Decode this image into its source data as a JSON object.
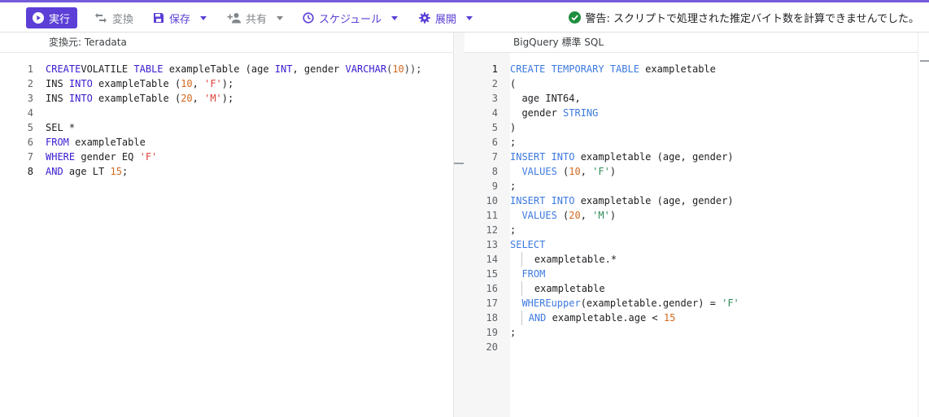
{
  "toolbar": {
    "run_label": "実行",
    "convert_label": "変換",
    "save_label": "保存",
    "share_label": "共有",
    "schedule_label": "スケジュール",
    "deploy_label": "展開",
    "warning_text": "警告: スクリプトで処理された推定バイト数を計算できませんでした。"
  },
  "left_pane": {
    "title": "変換元: Teradata",
    "lines": [
      {
        "n": "1",
        "tokens": [
          [
            "kw",
            "CREATE"
          ],
          [
            "",
            "VOLATILE "
          ],
          [
            "kw",
            "TABLE"
          ],
          [
            "",
            " exampleTable (age "
          ],
          [
            "kw",
            "INT"
          ],
          [
            "",
            ", gender "
          ],
          [
            "kw",
            "VARCHAR"
          ],
          [
            "punc",
            "("
          ],
          [
            "num",
            "10"
          ],
          [
            "punc",
            "));"
          ]
        ]
      },
      {
        "n": "2",
        "tokens": [
          [
            "",
            "INS "
          ],
          [
            "kw",
            "INTO"
          ],
          [
            "",
            " exampleTable ("
          ],
          [
            "num",
            "10"
          ],
          [
            "",
            ", "
          ],
          [
            "str",
            "'F'"
          ],
          [
            "",
            ");"
          ]
        ]
      },
      {
        "n": "3",
        "tokens": [
          [
            "",
            "INS "
          ],
          [
            "kw",
            "INTO"
          ],
          [
            "",
            " exampleTable ("
          ],
          [
            "num",
            "20"
          ],
          [
            "",
            ", "
          ],
          [
            "str",
            "'M'"
          ],
          [
            "",
            ");"
          ]
        ]
      },
      {
        "n": "4",
        "tokens": []
      },
      {
        "n": "5",
        "tokens": [
          [
            "",
            "SEL *"
          ]
        ]
      },
      {
        "n": "6",
        "tokens": [
          [
            "kw",
            "FROM"
          ],
          [
            "",
            " exampleTable"
          ]
        ]
      },
      {
        "n": "7",
        "tokens": [
          [
            "kw",
            "WHERE"
          ],
          [
            "",
            " gender EQ "
          ],
          [
            "str",
            "'F'"
          ]
        ]
      },
      {
        "n": "8",
        "active": true,
        "tokens": [
          [
            "kw",
            "AND"
          ],
          [
            "",
            " age LT "
          ],
          [
            "num",
            "15"
          ],
          [
            "",
            ";"
          ]
        ]
      }
    ]
  },
  "right_pane": {
    "title": "BigQuery 標準 SQL",
    "lines": [
      {
        "n": "1",
        "active": true,
        "tokens": [
          [
            "fn",
            "CREATE TEMPORARY TABLE"
          ],
          [
            "",
            " exampletable"
          ]
        ]
      },
      {
        "n": "2",
        "tokens": [
          [
            "",
            "("
          ]
        ]
      },
      {
        "n": "3",
        "guide": 1,
        "tokens": [
          [
            "",
            "age INT64,"
          ]
        ]
      },
      {
        "n": "4",
        "guide": 1,
        "tokens": [
          [
            "",
            "gender "
          ],
          [
            "fn",
            "STRING"
          ]
        ]
      },
      {
        "n": "5",
        "tokens": [
          [
            "",
            ")"
          ]
        ]
      },
      {
        "n": "6",
        "tokens": [
          [
            "",
            ";"
          ]
        ]
      },
      {
        "n": "7",
        "tokens": [
          [
            "fn",
            "INSERT INTO"
          ],
          [
            "",
            " exampletable (age, gender)"
          ]
        ]
      },
      {
        "n": "8",
        "guide": 1,
        "tokens": [
          [
            "fn",
            "VALUES"
          ],
          [
            "",
            " ("
          ],
          [
            "num",
            "10"
          ],
          [
            "",
            ", "
          ],
          [
            "str2",
            "'F'"
          ],
          [
            "",
            ")"
          ]
        ]
      },
      {
        "n": "9",
        "tokens": [
          [
            "",
            ";"
          ]
        ]
      },
      {
        "n": "10",
        "tokens": [
          [
            "fn",
            "INSERT INTO"
          ],
          [
            "",
            " exampletable (age, gender)"
          ]
        ]
      },
      {
        "n": "11",
        "guide": 1,
        "tokens": [
          [
            "fn",
            "VALUES"
          ],
          [
            "",
            " ("
          ],
          [
            "num",
            "20"
          ],
          [
            "",
            ", "
          ],
          [
            "str2",
            "'M'"
          ],
          [
            "",
            ")"
          ]
        ]
      },
      {
        "n": "12",
        "tokens": [
          [
            "",
            ";"
          ]
        ]
      },
      {
        "n": "13",
        "tokens": [
          [
            "fn",
            "SELECT"
          ]
        ]
      },
      {
        "n": "14",
        "guide": 2,
        "tokens": [
          [
            "",
            "exampletable.*"
          ]
        ]
      },
      {
        "n": "15",
        "guide": 1,
        "tokens": [
          [
            "fn",
            "FROM"
          ]
        ]
      },
      {
        "n": "16",
        "guide": 2,
        "tokens": [
          [
            "",
            "exampletable"
          ]
        ]
      },
      {
        "n": "17",
        "guide": 1,
        "tokens": [
          [
            "fn",
            "WHERE"
          ],
          [
            " ",
            ""
          ],
          [
            "fn",
            "upper"
          ],
          [
            "",
            "(exampletable.gender) = "
          ],
          [
            "str2",
            "'F'"
          ]
        ]
      },
      {
        "n": "18",
        "guide": 3,
        "tokens": [
          [
            "fn",
            "AND"
          ],
          [
            "",
            " exampletable.age < "
          ],
          [
            "num",
            "15"
          ]
        ]
      },
      {
        "n": "19",
        "tokens": [
          [
            "",
            ";"
          ]
        ]
      },
      {
        "n": "20",
        "tokens": []
      }
    ]
  },
  "colors": {
    "accent": "#5b3fd6",
    "success": "#1e8e3e"
  },
  "icons": [
    "play-icon",
    "swap-icon",
    "save-icon",
    "person-add-icon",
    "clock-icon",
    "gear-icon",
    "check-circle-icon"
  ]
}
